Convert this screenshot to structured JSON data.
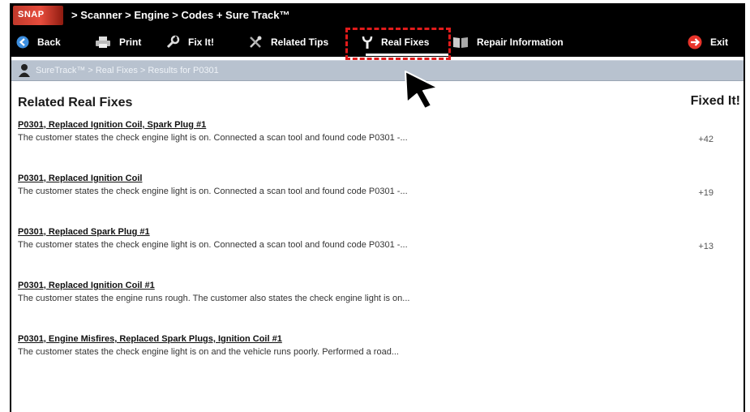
{
  "titlebar": {
    "logo_text": "SNAP",
    "path": "> Scanner  > Engine  > Codes + Sure Track™"
  },
  "toolbar": {
    "back": "Back",
    "print": "Print",
    "fixit": "Fix It!",
    "related_tips": "Related Tips",
    "real_fixes": "Real Fixes",
    "repair_info": "Repair Information",
    "exit": "Exit"
  },
  "navbar": {
    "crumb": "SureTrack™  > Real Fixes > Results for P0301"
  },
  "main": {
    "heading": "Related Real Fixes",
    "fixed_it_header": "Fixed It!",
    "entries": [
      {
        "title": "P0301, Replaced Ignition Coil, Spark Plug #1",
        "desc": "The customer states the check engine light is on. Connected a scan tool and found code P0301 -...",
        "count": "+42"
      },
      {
        "title": "P0301, Replaced Ignition Coil",
        "desc": "The customer states the check engine light is on. Connected a scan tool and found code P0301 -...",
        "count": "+19"
      },
      {
        "title": "P0301, Replaced Spark Plug #1",
        "desc": "The customer states the check engine light is on. Connected a scan tool and found code P0301 -...",
        "count": "+13"
      },
      {
        "title": "P0301, Replaced Ignition Coil #1",
        "desc": "The customer states the engine runs rough. The customer also states the check engine light is on...",
        "count": ""
      },
      {
        "title": "P0301, Engine Misfires, Replaced Spark Plugs, Ignition Coil #1",
        "desc": "The customer states the check engine light is on and the vehicle runs poorly. Performed a road...",
        "count": ""
      }
    ]
  },
  "colors": {
    "highlight": "#e21b1b",
    "navbar": "#b8c2cf",
    "exit_icon": "#e8342b"
  }
}
